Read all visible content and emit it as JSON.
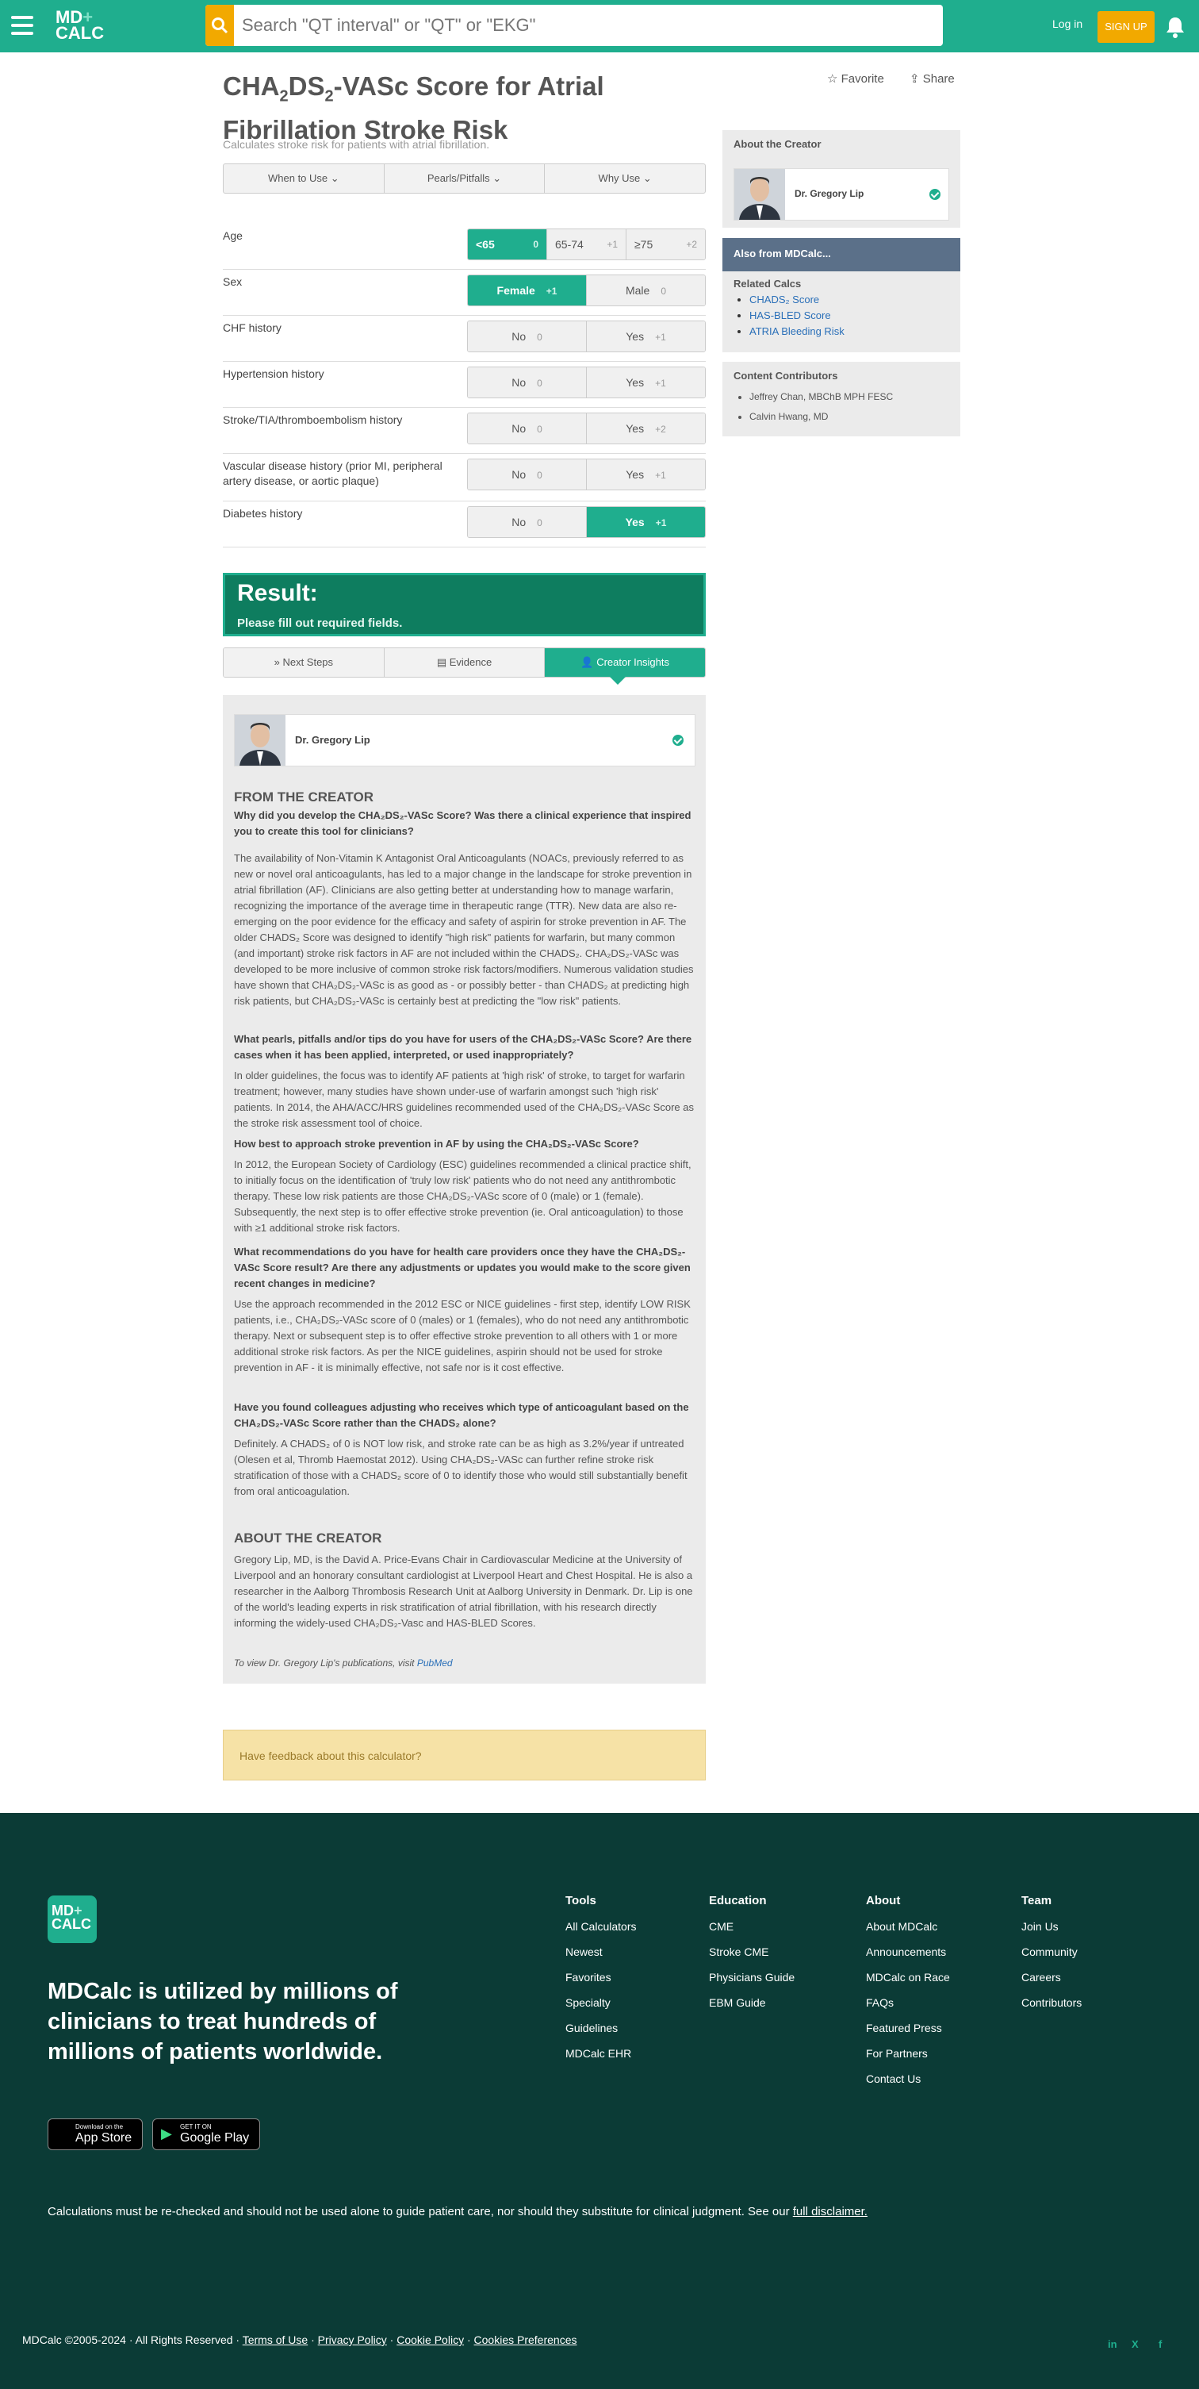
{
  "header": {
    "logo_top": "MD",
    "logo_bottom": "CALC",
    "search_placeholder": "Search \"QT interval\" or \"QT\" or \"EKG\"",
    "login": "Log in",
    "signup": "SIGN UP"
  },
  "page": {
    "title_parts": [
      "CHA",
      "2",
      "DS",
      "2",
      "-VASc Score for Atrial Fibrillation Stroke Risk"
    ],
    "subtitle": "Calculates stroke risk for patients with atrial fibrillation.",
    "favorite": "Favorite",
    "share": "Share",
    "tabs": [
      "When to Use",
      "Pearls/Pitfalls",
      "Why Use"
    ]
  },
  "questions": [
    {
      "label": "Age",
      "options": [
        {
          "t": "<65",
          "p": "0",
          "sel": true
        },
        {
          "t": "65-74",
          "p": "+1"
        },
        {
          "t": "≥75",
          "p": "+2"
        }
      ]
    },
    {
      "label": "Sex",
      "options": [
        {
          "t": "Female",
          "p": "+1",
          "sel": true
        },
        {
          "t": "Male",
          "p": "0"
        }
      ]
    },
    {
      "label": "CHF history",
      "options": [
        {
          "t": "No",
          "p": "0"
        },
        {
          "t": "Yes",
          "p": "+1"
        }
      ]
    },
    {
      "label": "Hypertension history",
      "options": [
        {
          "t": "No",
          "p": "0"
        },
        {
          "t": "Yes",
          "p": "+1"
        }
      ]
    },
    {
      "label": "Stroke/TIA/thromboembolism history",
      "options": [
        {
          "t": "No",
          "p": "0"
        },
        {
          "t": "Yes",
          "p": "+2"
        }
      ]
    },
    {
      "label": "Vascular disease history (prior MI, peripheral artery disease, or aortic plaque)",
      "options": [
        {
          "t": "No",
          "p": "0"
        },
        {
          "t": "Yes",
          "p": "+1"
        }
      ]
    },
    {
      "label": "Diabetes history",
      "options": [
        {
          "t": "No",
          "p": "0"
        },
        {
          "t": "Yes",
          "p": "+1",
          "sel": true
        }
      ]
    }
  ],
  "result": {
    "title": "Result:",
    "text": "Please fill out required fields.",
    "tabs": [
      "Next Steps",
      "Evidence",
      "Creator Insights"
    ]
  },
  "creator": {
    "name": "Dr. Gregory Lip",
    "from_heading": "FROM THE CREATOR",
    "about_heading": "ABOUT THE CREATOR",
    "q1": "Why did you develop the CHA₂DS₂-VASc Score? Was there a clinical experience that inspired you to create this tool for clinicians?",
    "a1": "The availability of Non-Vitamin K Antagonist Oral Anticoagulants (NOACs, previously referred to as new or novel oral anticoagulants, has led to a major change in the landscape for stroke prevention in atrial fibrillation (AF). Clinicians are also getting better at understanding how to manage warfarin, recognizing the importance of the average time in therapeutic range (TTR). New data are also re-emerging on the poor evidence for the efficacy and safety of aspirin for stroke prevention in AF. The older CHADS₂ Score was designed to identify \"high risk\" patients for warfarin, but many common (and important) stroke risk factors in AF are not included within the CHADS₂. CHA₂DS₂-VASc was developed to be more inclusive of common stroke risk factors/modifiers. Numerous validation studies have shown that CHA₂DS₂-VASc is as good as - or possibly better - than CHADS₂ at predicting high risk patients, but CHA₂DS₂-VASc is certainly best at predicting the \"low risk\" patients.",
    "q2": "What pearls, pitfalls and/or tips do you have for users of the CHA₂DS₂-VASc Score? Are there cases when it has been applied, interpreted, or used inappropriately?",
    "a2": "In older guidelines, the focus was to identify AF patients at 'high risk' of stroke, to target for warfarin treatment; however, many studies have shown under-use of warfarin amongst such 'high risk' patients. In 2014, the AHA/ACC/HRS guidelines recommended used of the CHA₂DS₂-VASc Score as the stroke risk assessment tool of choice.",
    "q3": "How best to approach stroke prevention in AF by using the CHA₂DS₂-VASc Score?",
    "a3": "In 2012, the European Society of Cardiology (ESC) guidelines recommended a clinical practice shift, to initially focus on the identification of 'truly low risk' patients who do not need any antithrombotic therapy. These low risk patients are those CHA₂DS₂-VASc score of 0 (male) or 1 (female). Subsequently, the next step is to offer effective stroke prevention (ie. Oral anticoagulation) to those with ≥1 additional stroke risk factors.",
    "q4": "What recommendations do you have for health care providers once they have the CHA₂DS₂-VASc Score result? Are there any adjustments or updates you would make to the score given recent changes in medicine?",
    "a4": "Use the approach recommended in the 2012 ESC or NICE guidelines - first step, identify LOW RISK patients, i.e., CHA₂DS₂-VASc score of 0 (males) or 1 (females), who do not need any antithrombotic therapy. Next or subsequent step is to offer effective stroke prevention to all others with 1 or more additional stroke risk factors. As per the NICE guidelines, aspirin should not be used for stroke prevention in AF - it is minimally effective, not safe nor is it cost effective.",
    "q5": "Have you found colleagues adjusting who receives which type of anticoagulant based on the CHA₂DS₂-VASc Score rather than the CHADS₂ alone?",
    "a5": "Definitely. A CHADS₂ of 0 is NOT low risk, and stroke rate can be as high as 3.2%/year if untreated (Olesen et al, Thromb Haemostat 2012). Using CHA₂DS₂-VASc can further refine stroke risk stratification of those with a CHADS₂ score of 0 to identify those who would still substantially benefit from oral anticoagulation.",
    "about": "Gregory Lip, MD, is the David A. Price-Evans Chair in Cardiovascular Medicine at the University of Liverpool and an honorary consultant cardiologist at Liverpool Heart and Chest Hospital. He is also a researcher in the Aalborg Thrombosis Research Unit at Aalborg University in Denmark. Dr. Lip is one of the world's leading experts in risk stratification of atrial fibrillation, with his research directly informing the widely-used CHA₂DS₂-Vasc and HAS-BLED Scores.",
    "pubs": "To view Dr. Gregory Lip's publications, visit",
    "pubs_link": "PubMed"
  },
  "feedback": "Have feedback about this calculator?",
  "sidebar": {
    "about_h": "About the Creator",
    "creator": "Dr. Gregory Lip",
    "also_h": "Also from MDCalc...",
    "related_h": "Related Calcs",
    "related": [
      "CHADS₂ Score",
      "HAS-BLED Score",
      "ATRIA Bleeding Risk"
    ],
    "contrib_h": "Content Contributors",
    "contributors": [
      "Jeffrey Chan, MBChB MPH FESC",
      "Calvin Hwang, MD"
    ]
  },
  "footer": {
    "logo_top": "MD",
    "logo_bottom": "CALC",
    "tagline": "MDCalc is utilized by millions of clinicians to treat hundreds of millions of patients worldwide.",
    "app_small": "Download on the",
    "app_big": "App Store",
    "play_small": "GET IT ON",
    "play_big": "Google Play",
    "cols": [
      {
        "h": "Tools",
        "items": [
          "All Calculators",
          "Newest",
          "Favorites",
          "Specialty",
          "Guidelines",
          "MDCalc EHR"
        ]
      },
      {
        "h": "Education",
        "items": [
          "CME",
          "Stroke CME",
          "Physicians Guide",
          "EBM Guide"
        ]
      },
      {
        "h": "About",
        "items": [
          "About MDCalc",
          "Announcements",
          "MDCalc on Race",
          "FAQs",
          "Featured Press",
          "For Partners",
          "Contact Us"
        ]
      },
      {
        "h": "Team",
        "items": [
          "Join Us",
          "Community",
          "Careers",
          "Contributors"
        ]
      }
    ],
    "disclaimer": "Calculations must be re-checked and should not be used alone to guide patient care, nor should they substitute for clinical judgment. See our",
    "disclaimer_link": "full disclaimer.",
    "copyright": "MDCalc ©2005-2024  ·  All Rights Reserved  ·",
    "links": [
      "Terms of Use",
      "Privacy Policy",
      "Cookie Policy",
      "Cookies Preferences"
    ],
    "social": [
      "in",
      "X",
      "f"
    ]
  },
  "colors": {
    "brand": "#1fae8e",
    "accent": "#f2a900",
    "footer_bg": "#0b3b36"
  }
}
